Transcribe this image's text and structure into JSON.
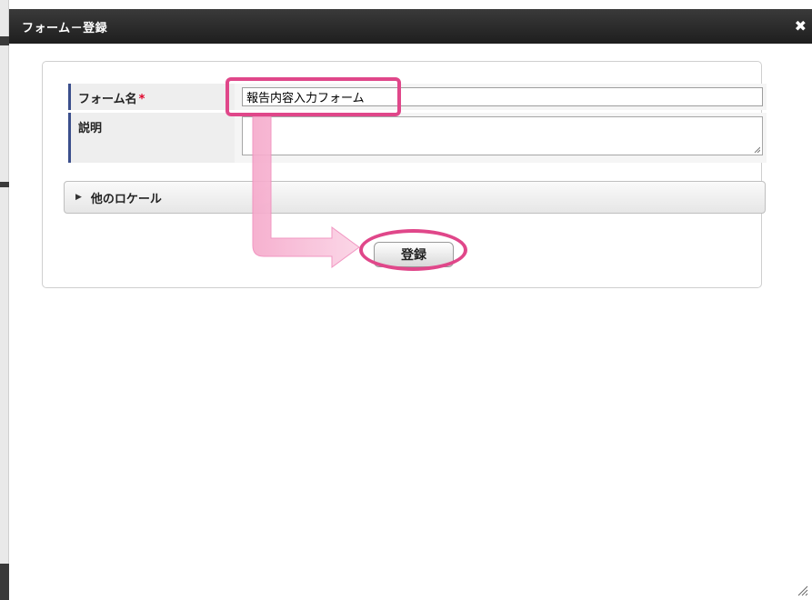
{
  "dialog": {
    "title": "フォーム－登録",
    "close_icon": "close-icon"
  },
  "form": {
    "name_label": "フォーム名",
    "required_mark": "*",
    "name_value": "報告内容入力フォーム",
    "description_label": "説明",
    "description_value": ""
  },
  "locale_section": {
    "label": "他のロケール",
    "expander_icon": "triangle-right-icon"
  },
  "actions": {
    "register_label": "登録"
  },
  "colors": {
    "highlight": "#e0478a",
    "titlebar": "#2a2a2a",
    "label_accent": "#3b4f8c",
    "required": "#e0002a"
  }
}
